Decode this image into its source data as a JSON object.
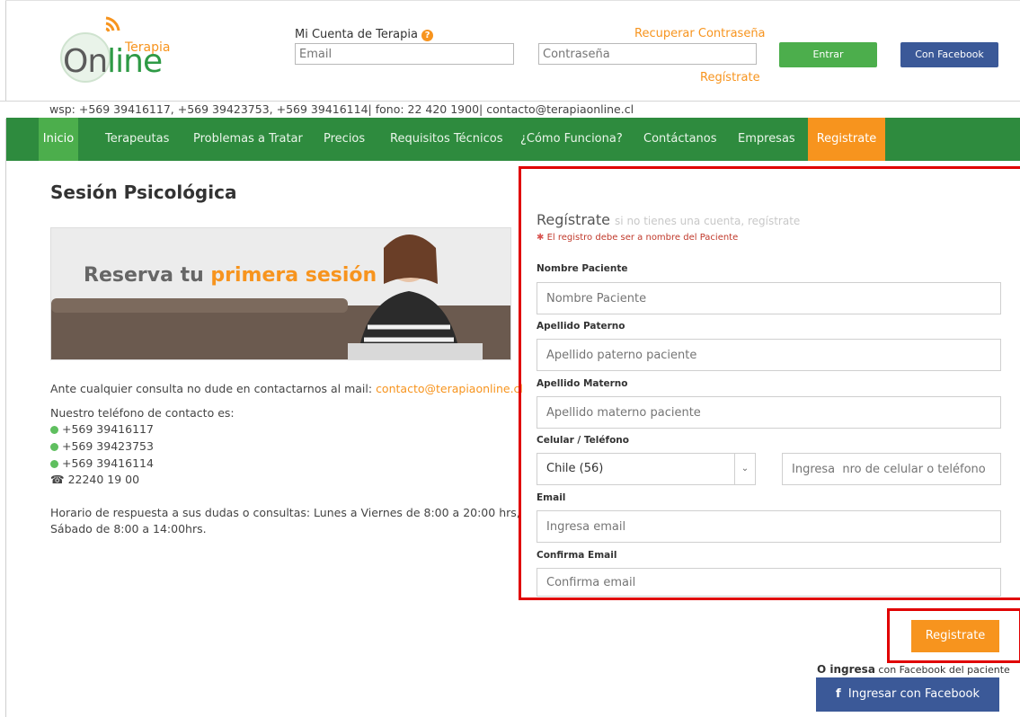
{
  "brand": {
    "line1": "Terapia",
    "line2_a": "On",
    "line2_b": "line"
  },
  "header": {
    "account_label": "Mi Cuenta de Terapia",
    "email_placeholder": "Email",
    "password_placeholder": "Contraseña",
    "recover_link": "Recuperar Contraseña",
    "register_link": "Regístrate",
    "login_button": "Entrar",
    "facebook_button": "Con Facebook"
  },
  "contact_strip": "wsp: +569 39416117, +569 39423753, +569 39416114| fono: 22 420 1900| contacto@terapiaonline.cl",
  "nav": [
    {
      "label": "Inicio"
    },
    {
      "label": "Terapeutas"
    },
    {
      "label": "Problemas a Tratar"
    },
    {
      "label": "Precios"
    },
    {
      "label": "Requisitos Técnicos"
    },
    {
      "label": "¿Cómo Funciona?"
    },
    {
      "label": "Contáctanos"
    },
    {
      "label": "Empresas"
    },
    {
      "label": "Registrate"
    }
  ],
  "left": {
    "title": "Sesión Psicológica",
    "banner_a": "Reserva tu ",
    "banner_b": "primera sesión",
    "contact_prefix": "Ante cualquier consulta no dude en contactarnos al mail: ",
    "contact_email": "contacto@terapiaonline.cl",
    "phones_title": "Nuestro teléfono de contacto es:",
    "phones": [
      "+569 39416117",
      "+569 39423753",
      "+569 39416114"
    ],
    "landline": "22240 19 00",
    "hours_1": "Horario de respuesta a sus dudas o consultas: Lunes a Viernes de 8:00 a 20:00 hrs,",
    "hours_2": "Sábado de 8:00 a 14:00hrs."
  },
  "form": {
    "title": "Regístrate",
    "subtitle": "si no tienes una cuenta, regístrate",
    "note": "El registro debe ser a nombre del Paciente",
    "fields": {
      "nombre_label": "Nombre Paciente",
      "nombre_placeholder": "Nombre Paciente",
      "paterno_label": "Apellido Paterno",
      "paterno_placeholder": "Apellido paterno paciente",
      "materno_label": "Apellido Materno",
      "materno_placeholder": "Apellido materno paciente",
      "phone_label": "Celular / Teléfono",
      "country_value": "Chile (56)",
      "phone_placeholder": "Ingresa  nro de celular o teléfono",
      "email_label": "Email",
      "email_placeholder": "Ingresa email",
      "confirm_label": "Confirma Email",
      "confirm_placeholder": "Confirma email"
    },
    "submit": "Registrate",
    "or_bold": "O ingresa",
    "or_small": "con Facebook del paciente",
    "facebook_login": "Ingresar con Facebook"
  }
}
